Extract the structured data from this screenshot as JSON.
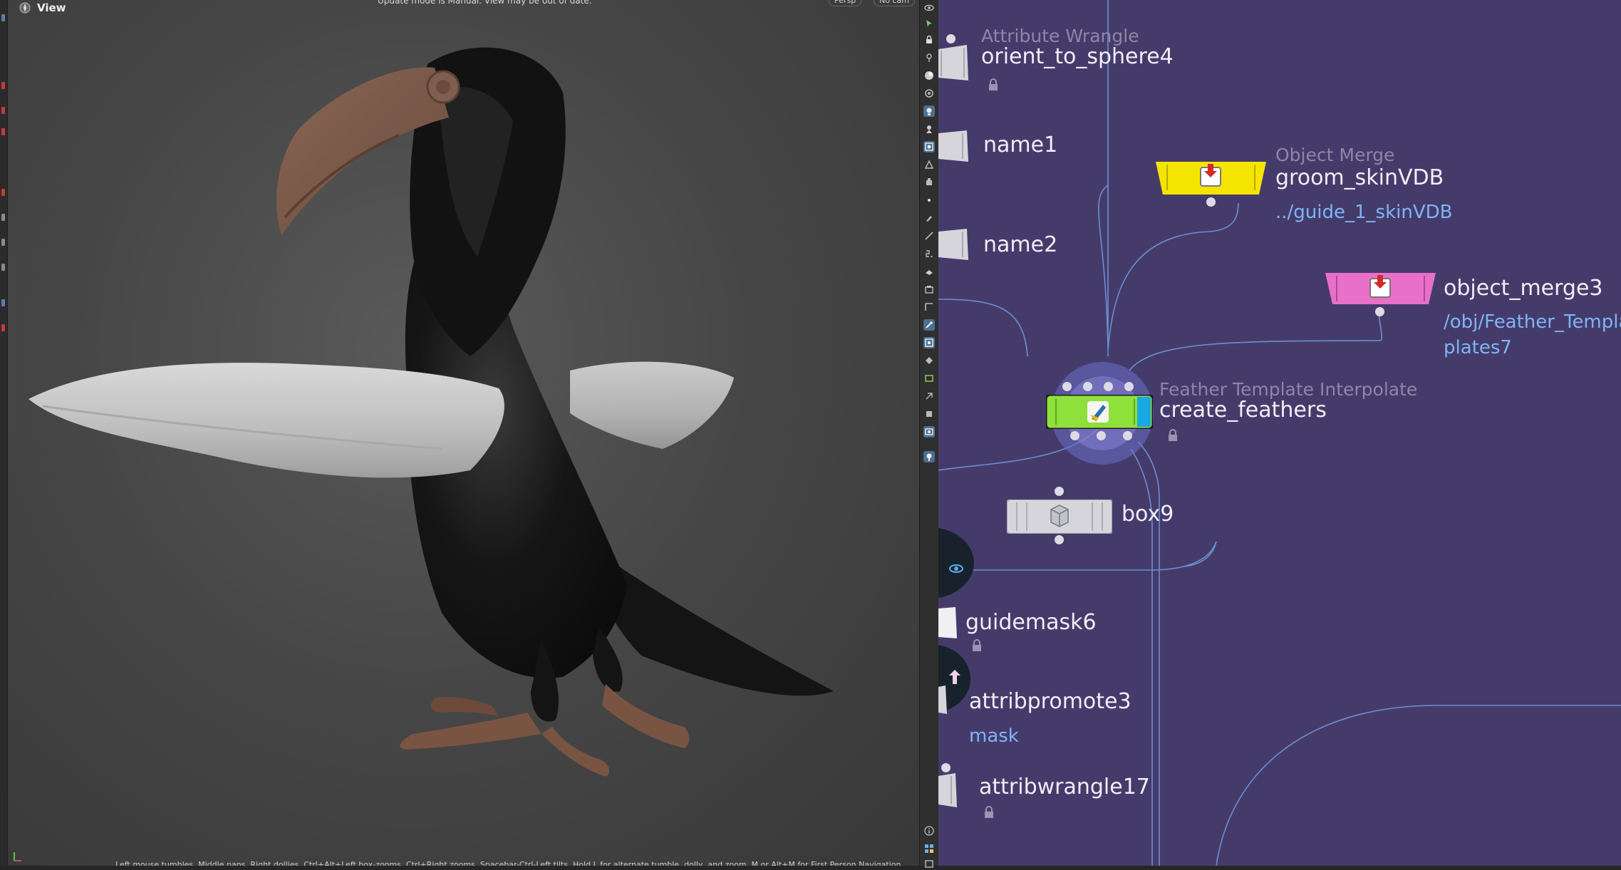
{
  "viewport": {
    "title": "View",
    "update_message": "Update mode is Manual. View may be out of date.",
    "camera_label": "Persp",
    "cam_label": "No cam",
    "help_text": "Left mouse tumbles. Middle pans. Right dollies. Ctrl+Alt+Left box-zooms. Ctrl+Right zooms. Spacebar-Ctrl-Left tilts. Hold L for alternate tumble, dolly, and zoom. M or Alt+M for First Person Navigation.",
    "colors": {
      "background": "#474747",
      "beak": "#7a5a4a",
      "wing": "#c8c8c8",
      "body": "#151515",
      "feet": "#7a5443"
    }
  },
  "network": {
    "background": "#453b6b",
    "nodes": [
      {
        "type": "Attribute Wrangle",
        "name": "orient_to_sphere4",
        "locked": true
      },
      {
        "name": "name1"
      },
      {
        "name": "name2"
      },
      {
        "type": "Object Merge",
        "name": "groom_skinVDB",
        "param": "../guide_1_skinVDB",
        "color": "#f5e400"
      },
      {
        "name": "object_merge3",
        "param_line1": "/obj/Feather_Templa",
        "param_line2": "plates7",
        "color": "#e870c8"
      },
      {
        "type": "Feather Template Interpolate",
        "name": "create_feathers",
        "locked": true,
        "color": "#8ee03a"
      },
      {
        "name": "box9"
      },
      {
        "name": "guidemask6",
        "locked": true
      },
      {
        "name": "attribpromote3",
        "param": "mask"
      },
      {
        "name": "attribwrangle17",
        "locked": true
      }
    ]
  },
  "shelf": {
    "tools": [
      "view-icon",
      "select-icon",
      "lock-icon",
      "pin-icon",
      "shading-icon",
      "visibility-icon",
      "camera-icon",
      "snap-icon",
      "render-icon",
      "lights-icon",
      "point-icon",
      "brush-icon",
      "measure-icon",
      "number-icon",
      "scale-icon",
      "handles-icon",
      "frame-icon",
      "paint-icon",
      "grid-icon",
      "diamond-icon",
      "image-icon",
      "wire-icon",
      "square-icon",
      "display-icon",
      "search-icon",
      "info-icon",
      "layout-icon",
      "window-icon"
    ]
  }
}
